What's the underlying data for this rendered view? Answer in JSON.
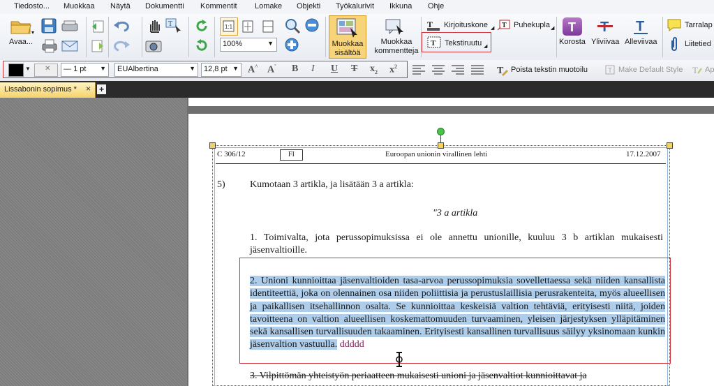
{
  "menu": [
    "Tiedosto...",
    "Muokkaa",
    "Näytä",
    "Dokumentti",
    "Kommentit",
    "Lomake",
    "Objekti",
    "Työkalurivit",
    "Ikkuna",
    "Ohje"
  ],
  "ribbon": {
    "open_label": "Avaa...",
    "zoom_value": "100%",
    "edit_content_label": "Muokkaa\nsisältöä",
    "edit_comments_label": "Muokkaa\nkommentteja",
    "typewriter_label": "Kirjoituskone",
    "callout_label": "Puhekupla",
    "textbox_label": "Tekstiruutu",
    "highlight_label": "Korosta",
    "strikeout_label": "Yliviivaa",
    "underline_label": "Alleviivaa",
    "sticky_label": "Tarralap",
    "attach_label": "Liitetied"
  },
  "format": {
    "line_width": "1 pt",
    "font_name": "EUAlbertina",
    "font_size": "12,8 pt",
    "remove_format_label": "Poista tekstin muotoilu",
    "make_default_label": "Make Default Style",
    "apply_label": "Ap"
  },
  "tab": {
    "title": "Lissabonin sopimus *",
    "close": "×",
    "add": "+"
  },
  "doc": {
    "header_left": "C 306/12",
    "header_lang": "FI",
    "header_center": "Euroopan unionin virallinen lehti",
    "header_right": "17.12.2007",
    "item5_num": "5)",
    "item5_text": "Kumotaan 3 artikla, ja lisätään 3 a artikla:",
    "article_title": "\"3 a artikla",
    "para1": "1.      Toimivalta, jota perussopimuksissa ei ole annettu unionille, kuuluu 3 b artiklan mukaisesti jäsenvaltioille.",
    "para2_selected": "2.      Unioni kunnioittaa jäsenvaltioiden tasa-arvoa perussopimuksia sovellettaessa sekä niiden kansallista identiteettiä, joka on olennainen osa niiden poliittisia ja perustuslaillisia perusrakenteita, myös alueellisen ja paikallisen itsehallinnon osalta. Se kunnioittaa keskeisiä valtion tehtäviä, erityisesti niitä, joiden tavoitteena on valtion alueellisen koskemattomuuden turvaaminen, yleisen järjestyksen ylläpitäminen sekä kansallisen turvallisuuden takaaminen. Erityisesti kansallinen turvallisuus säilyy yksinomaan kunkin jäsenvaltion vastuulla.",
    "para2_added": "ddddd",
    "para3": "3.      Vilpittömän yhteistyön periaatteen mukaisesti unioni ja jäsenvaltiot kunnioittavat ja"
  }
}
